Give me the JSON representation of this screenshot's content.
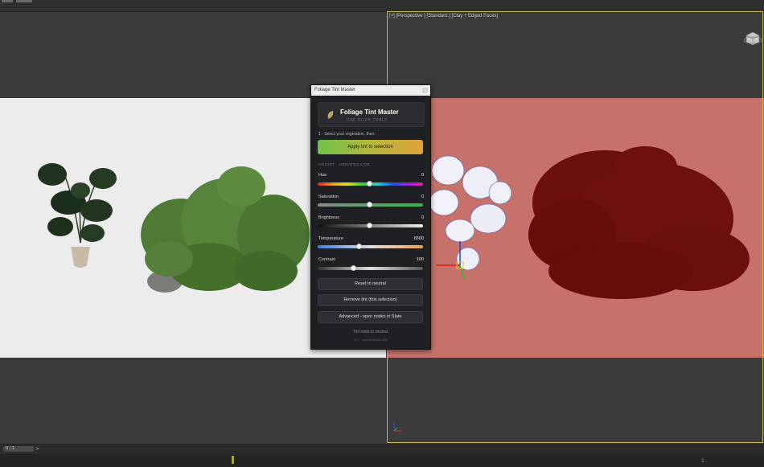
{
  "viewport": {
    "label": "[+] [Perspective ] [Standard ] [Clay + Edged Faces]"
  },
  "timeline": {
    "frame_counter": "0 / 1",
    "arrow": ">",
    "tick_label": "1"
  },
  "panel": {
    "window_title": "Foliage Tint Master",
    "title": "Foliage Tint Master",
    "subtitle": "ONE CLICK TOOLS",
    "step_text": "1 - Select your vegetation, then:",
    "apply_button": "Apply tint to selection",
    "section_label": "ADJUST · UPDATES LIVE",
    "sliders": [
      {
        "label": "Hue",
        "value": "0",
        "position": 0.5
      },
      {
        "label": "Saturation",
        "value": "0",
        "position": 0.5
      },
      {
        "label": "Brightness",
        "value": "0",
        "position": 0.5
      },
      {
        "label": "Temperature",
        "value": "6500",
        "position": 0.4
      },
      {
        "label": "Contrast",
        "value": "100",
        "position": 0.35
      }
    ],
    "buttons": {
      "reset": "Reset to neutral",
      "remove": "Remove tint (this selection)",
      "advanced": "Advanced - open nodes in Slate"
    },
    "status": "Tint reset to neutral.",
    "footer": "v1.0 · oneclicktools.com"
  },
  "colors": {
    "accent_green": "#6cc24a",
    "accent_orange": "#e0a33a",
    "viewport_active_border": "#c9b64a",
    "render_red": "#c6726a"
  }
}
